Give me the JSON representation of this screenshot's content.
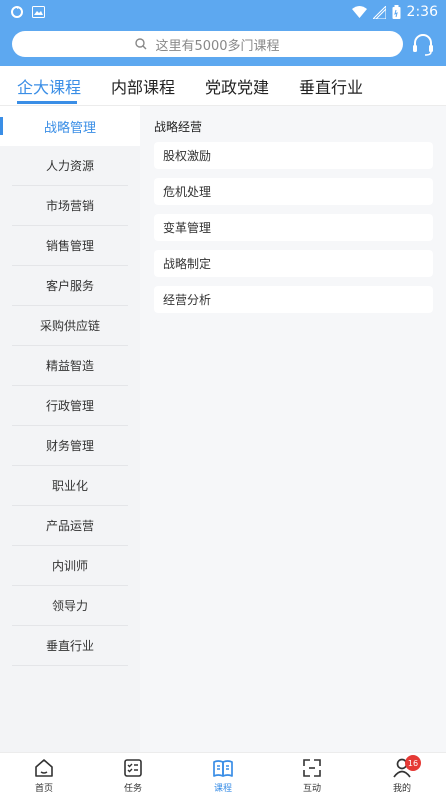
{
  "status_bar": {
    "time": "2:36"
  },
  "search": {
    "placeholder": "这里有5000多门课程"
  },
  "tabs": [
    {
      "label": "企大课程",
      "active": true
    },
    {
      "label": "内部课程",
      "active": false
    },
    {
      "label": "党政党建",
      "active": false
    },
    {
      "label": "垂直行业",
      "active": false
    }
  ],
  "sidebar": {
    "items": [
      {
        "label": "战略管理",
        "active": true
      },
      {
        "label": "人力资源"
      },
      {
        "label": "市场营销"
      },
      {
        "label": "销售管理"
      },
      {
        "label": "客户服务"
      },
      {
        "label": "采购供应链"
      },
      {
        "label": "精益智造"
      },
      {
        "label": "行政管理"
      },
      {
        "label": "财务管理"
      },
      {
        "label": "职业化"
      },
      {
        "label": "产品运营"
      },
      {
        "label": "内训师"
      },
      {
        "label": "领导力"
      },
      {
        "label": "垂直行业"
      }
    ]
  },
  "content": {
    "section_title": "战略经营",
    "items": [
      "股权激励",
      "危机处理",
      "变革管理",
      "战略制定",
      "经营分析"
    ]
  },
  "bottom_nav": {
    "items": [
      {
        "label": "首页",
        "icon": "home-icon"
      },
      {
        "label": "任务",
        "icon": "task-icon"
      },
      {
        "label": "课程",
        "icon": "book-icon",
        "active": true
      },
      {
        "label": "互动",
        "icon": "interact-icon"
      },
      {
        "label": "我的",
        "icon": "user-icon",
        "badge": "16"
      }
    ]
  },
  "colors": {
    "accent": "#3a8ee6",
    "header": "#5da8f0",
    "badge": "#e53935"
  }
}
